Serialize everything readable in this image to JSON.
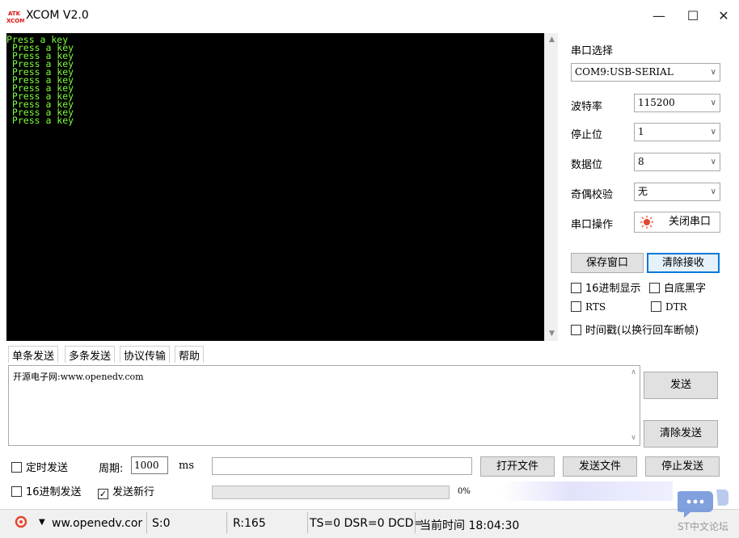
{
  "window": {
    "logo_text": "ATK\nXCOM",
    "title": "XCOM V2.0",
    "minimize": "—",
    "maximize": "☐",
    "close": "✕"
  },
  "terminal": {
    "lines": [
      "Press a key",
      " Press a key",
      " Press a key",
      " Press a key",
      " Press a key",
      " Press a key",
      " Press a key",
      " Press a key",
      " Press a key",
      " Press a key",
      " Press a key"
    ]
  },
  "serial": {
    "port_label": "串口选择",
    "port_value": "COM9:USB-SERIAL",
    "baud_label": "波特率",
    "baud_value": "115200",
    "stop_label": "停止位",
    "stop_value": "1",
    "data_label": "数据位",
    "data_value": "8",
    "parity_label": "奇偶校验",
    "parity_value": "无",
    "op_label": "串口操作",
    "op_button": "关闭串口",
    "save_window": "保存窗口",
    "clear_recv": "清除接收",
    "hex_display": "16进制显示",
    "white_bg": "白底黑字",
    "rts": "RTS",
    "dtr": "DTR",
    "timestamp": "时间戳(以换行回车断帧)"
  },
  "tabs": [
    "单条发送",
    "多条发送",
    "协议传输",
    "帮助"
  ],
  "send": {
    "text": "开源电子网:www.openedv.com",
    "send_button": "发送",
    "clear_send": "清除发送",
    "timed_send": "定时发送",
    "period_label": "周期:",
    "period_value": "1000",
    "period_unit": "ms",
    "open_file": "打开文件",
    "send_file": "发送文件",
    "stop_send": "停止发送",
    "hex_send": "16进制发送",
    "send_newline": "发送新行",
    "progress": "0%"
  },
  "status": {
    "url": "ww.openedv.cor",
    "sent": "S:0",
    "received": "R:165",
    "signals": "TS=0 DSR=0 DCD=",
    "time": "当前时间 18:04:30",
    "watermark": "ST中文论坛"
  },
  "colors": {
    "terminal_bg": "#000000",
    "terminal_fg": "#7cff3a",
    "accent": "#0078d7",
    "status_icon": "#e8452c"
  }
}
